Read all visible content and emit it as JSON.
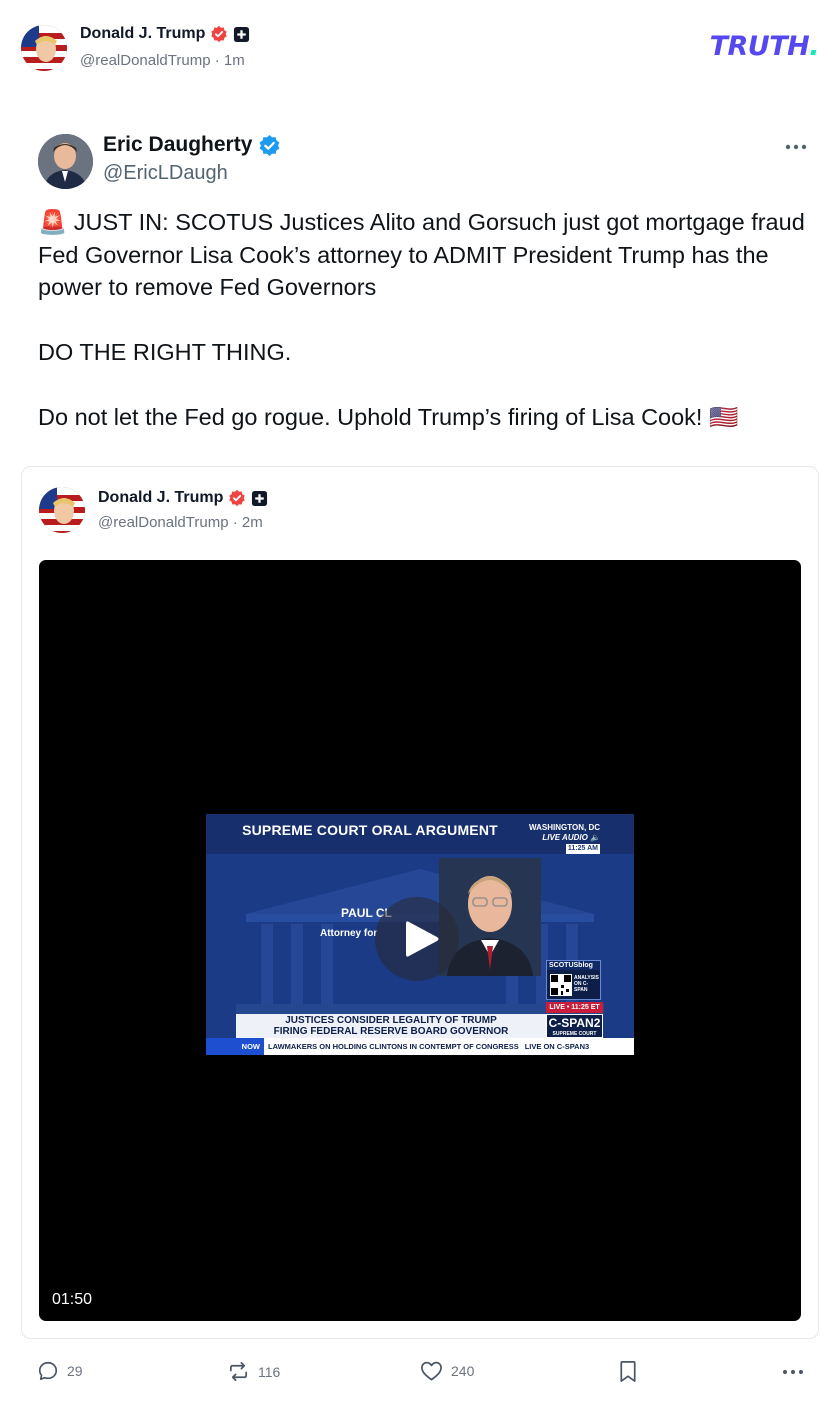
{
  "header": {
    "author_name": "Donald J. Trump",
    "author_handle": "@realDonaldTrump",
    "time_sep": "·",
    "time": "1m",
    "logo_text": "TRUTH",
    "logo_dot": ".",
    "colors": {
      "logo": "#5448ee",
      "logo_dot": "#17e6b7",
      "verified": "#ef4444"
    }
  },
  "tweet": {
    "author_name": "Eric Daugherty",
    "author_handle": "@EricLDaugh",
    "verified_color": "#1d9bf0",
    "paragraphs": [
      "🚨 JUST IN: SCOTUS Justices Alito and Gorsuch just got mortgage fraud Fed Governor Lisa Cook’s attorney to ADMIT President Trump has the power to remove Fed Governors",
      "DO THE RIGHT THING.",
      "Do not let the Fed go rogue. Uphold Trump’s firing of Lisa Cook! 🇺🇸"
    ]
  },
  "quoted_post": {
    "author_name": "Donald J. Trump",
    "author_handle": "@realDonaldTrump",
    "time_sep": "·",
    "time": "2m",
    "video": {
      "duration": "01:50",
      "thumbnail": {
        "title": "SUPREME COURT ORAL ARGUMENT",
        "location": "WASHINGTON, DC",
        "live_audio": "LIVE AUDIO 🔈",
        "clock": "11:25 AM",
        "name": "PAUL CL",
        "subtitle": "Attorney for",
        "scotusblog": "SCOTUSblog",
        "scotus_sub": "ANALYSIS ON C-SPAN",
        "live_badge": "LIVE • 11:25 ET",
        "network": "C-SPAN2",
        "network_sub": "SUPREME COURT",
        "banner_line1": "JUSTICES CONSIDER LEGALITY OF TRUMP",
        "banner_line2": "FIRING FEDERAL RESERVE BOARD GOVERNOR",
        "ticker_now": "NOW",
        "ticker_text": "LAWMAKERS ON HOLDING CLINTONS IN CONTEMPT OF CONGRESS",
        "ticker_live_on": "LIVE ON C-SPAN3"
      }
    }
  },
  "actions": {
    "replies": "29",
    "reposts": "116",
    "likes": "240"
  }
}
